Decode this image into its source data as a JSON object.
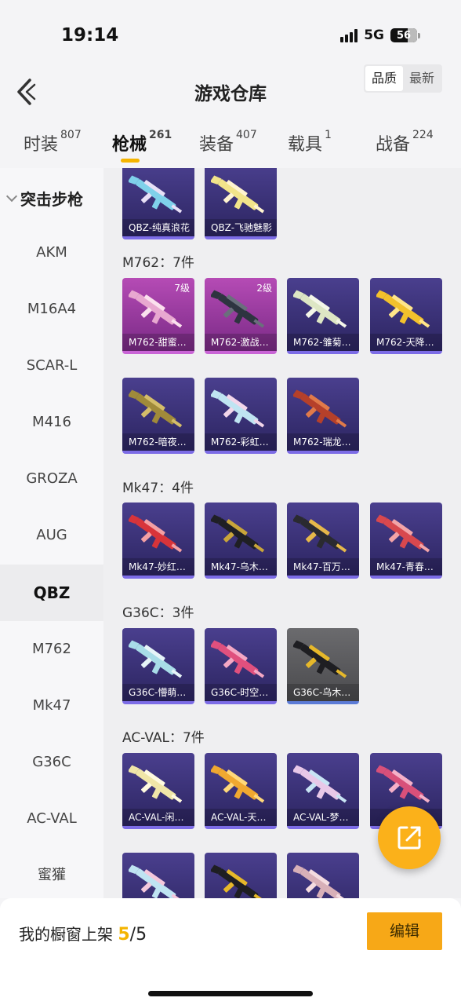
{
  "status": {
    "time": "19:14",
    "network": "5G",
    "battery": "56"
  },
  "header": {
    "title": "游戏仓库",
    "sort_quality": "品质",
    "sort_latest": "最新"
  },
  "tabs": [
    {
      "label": "时装",
      "count": "807"
    },
    {
      "label": "枪械",
      "count": "261"
    },
    {
      "label": "装备",
      "count": "407"
    },
    {
      "label": "载具",
      "count": "1"
    },
    {
      "label": "战备",
      "count": "224"
    }
  ],
  "sidebar": {
    "category": "突击步枪",
    "items": [
      "AKM",
      "M16A4",
      "SCAR-L",
      "M416",
      "GROZA",
      "AUG",
      "QBZ",
      "M762",
      "Mk47",
      "G36C",
      "AC-VAL",
      "蜜獾"
    ],
    "active": "QBZ"
  },
  "qbz": {
    "cards": [
      "QBZ-纯真浪花",
      "QBZ-飞驰魅影"
    ]
  },
  "m762": {
    "title": "M762：7件",
    "cards": [
      "M762-甜蜜…",
      "M762-激战…",
      "M762-雏菊…",
      "M762-天降…",
      "M762-暗夜…",
      "M762-彩虹…",
      "M762-瑞龙…"
    ],
    "levels": [
      "7级",
      "2级"
    ]
  },
  "mk47": {
    "title": "Mk47：4件",
    "cards": [
      "Mk47-妙红…",
      "Mk47-乌木…",
      "Mk47-百万…",
      "Mk47-青春…"
    ]
  },
  "g36c": {
    "title": "G36C：3件",
    "cards": [
      "G36C-懵萌…",
      "G36C-时空…",
      "G36C-乌木…"
    ]
  },
  "acval": {
    "title": "AC-VAL：7件",
    "cards": [
      "AC-VAL-闲…",
      "AC-VAL-天…",
      "AC-VAL-梦…",
      ""
    ]
  },
  "footer": {
    "label": "我的橱窗上架",
    "current": "5",
    "total": "/5",
    "edit": "编辑"
  }
}
